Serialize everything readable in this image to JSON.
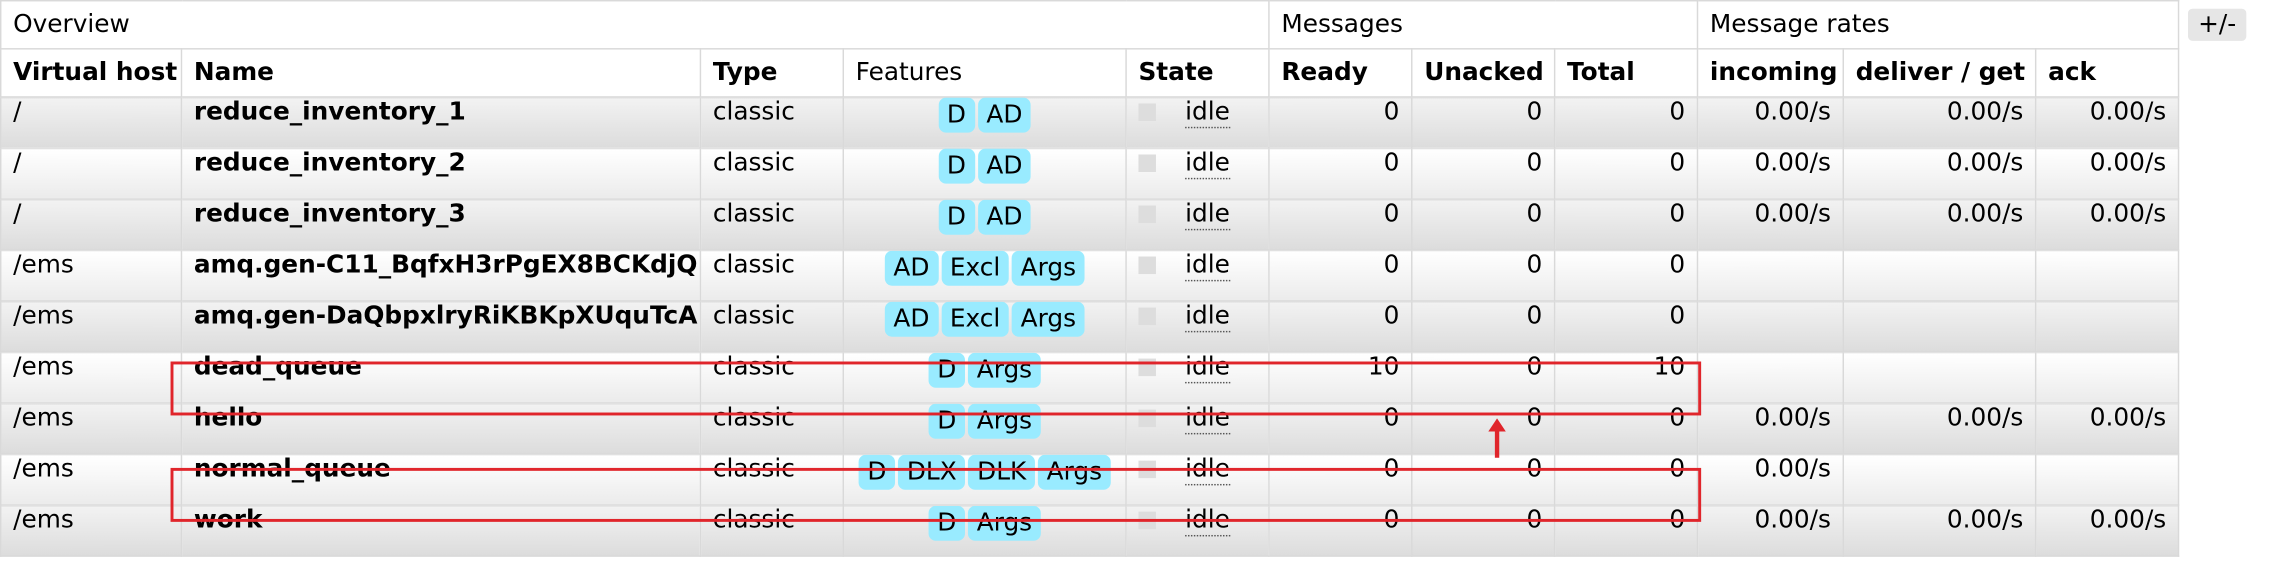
{
  "toggle_label": "+/-",
  "groups": {
    "overview": "Overview",
    "messages": "Messages",
    "message_rates": "Message rates"
  },
  "columns": [
    "Virtual host",
    "Name",
    "Type",
    "Features",
    "State",
    "Ready",
    "Unacked",
    "Total",
    "incoming",
    "deliver / get",
    "ack"
  ],
  "rows": [
    {
      "vhost": "/",
      "name": "reduce_inventory_1",
      "type": "classic",
      "features": [
        "D",
        "AD"
      ],
      "state": "idle",
      "ready": "0",
      "unacked": "0",
      "total": "0",
      "incoming": "0.00/s",
      "deliver": "0.00/s",
      "ack": "0.00/s"
    },
    {
      "vhost": "/",
      "name": "reduce_inventory_2",
      "type": "classic",
      "features": [
        "D",
        "AD"
      ],
      "state": "idle",
      "ready": "0",
      "unacked": "0",
      "total": "0",
      "incoming": "0.00/s",
      "deliver": "0.00/s",
      "ack": "0.00/s"
    },
    {
      "vhost": "/",
      "name": "reduce_inventory_3",
      "type": "classic",
      "features": [
        "D",
        "AD"
      ],
      "state": "idle",
      "ready": "0",
      "unacked": "0",
      "total": "0",
      "incoming": "0.00/s",
      "deliver": "0.00/s",
      "ack": "0.00/s"
    },
    {
      "vhost": "/ems",
      "name": "amq.gen-C11_BqfxH3rPgEX8BCKdjQ",
      "type": "classic",
      "features": [
        "AD",
        "Excl",
        "Args"
      ],
      "state": "idle",
      "ready": "0",
      "unacked": "0",
      "total": "0",
      "incoming": "",
      "deliver": "",
      "ack": ""
    },
    {
      "vhost": "/ems",
      "name": "amq.gen-DaQbpxlryRiKBKpXUquTcA",
      "type": "classic",
      "features": [
        "AD",
        "Excl",
        "Args"
      ],
      "state": "idle",
      "ready": "0",
      "unacked": "0",
      "total": "0",
      "incoming": "",
      "deliver": "",
      "ack": ""
    },
    {
      "vhost": "/ems",
      "name": "dead_queue",
      "type": "classic",
      "features": [
        "D",
        "Args"
      ],
      "state": "idle",
      "ready": "10",
      "unacked": "0",
      "total": "10",
      "incoming": "",
      "deliver": "",
      "ack": ""
    },
    {
      "vhost": "/ems",
      "name": "hello",
      "type": "classic",
      "features": [
        "D",
        "Args"
      ],
      "state": "idle",
      "ready": "0",
      "unacked": "0",
      "total": "0",
      "incoming": "0.00/s",
      "deliver": "0.00/s",
      "ack": "0.00/s"
    },
    {
      "vhost": "/ems",
      "name": "normal_queue",
      "type": "classic",
      "features": [
        "D",
        "DLX",
        "DLK",
        "Args"
      ],
      "state": "idle",
      "ready": "0",
      "unacked": "0",
      "total": "0",
      "incoming": "0.00/s",
      "deliver": "",
      "ack": ""
    },
    {
      "vhost": "/ems",
      "name": "work",
      "type": "classic",
      "features": [
        "D",
        "Args"
      ],
      "state": "idle",
      "ready": "0",
      "unacked": "0",
      "total": "0",
      "incoming": "0.00/s",
      "deliver": "0.00/s",
      "ack": "0.00/s"
    }
  ],
  "colors": {
    "highlight": "#e0252b",
    "badge": "#99ebff"
  }
}
